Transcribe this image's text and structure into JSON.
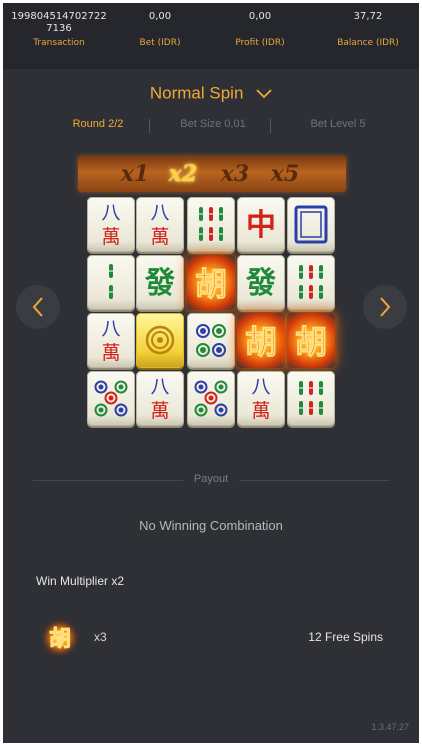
{
  "header": {
    "transaction": {
      "value_line1": "199804514702722",
      "value_line2": "7136",
      "label": "Transaction"
    },
    "bet": {
      "value": "0,00",
      "label": "Bet (IDR)"
    },
    "profit": {
      "value": "0,00",
      "label": "Profit (IDR)"
    },
    "balance": {
      "value": "37,72",
      "label": "Balance (IDR)"
    }
  },
  "mode": {
    "label": "Normal Spin",
    "icon": "chevron-down-icon"
  },
  "info": {
    "round": "Round 2/2",
    "bet_size": "Bet Size 0,01",
    "bet_level": "Bet Level 5"
  },
  "multipliers": {
    "items": [
      "x1",
      "x2",
      "x3",
      "x5"
    ],
    "active": "x2"
  },
  "reels": {
    "rows": [
      [
        "wan-8",
        "wan-8",
        "bamboo-6",
        "red-dragon",
        "white-dragon"
      ],
      [
        "bamboo-2",
        "green-dragon",
        "wild-hu",
        "green-dragon",
        "bamboo-6"
      ],
      [
        "wan-8",
        "golden-dot-1",
        "dots-4",
        "wild-hu",
        "wild-hu"
      ],
      [
        "dots-5",
        "wan-8",
        "dots-5",
        "wan-8",
        "bamboo-6"
      ]
    ]
  },
  "nav": {
    "left_icon": "chevron-left-icon",
    "right_icon": "chevron-right-icon"
  },
  "payout": {
    "label": "Payout",
    "message": "No Winning Combination"
  },
  "win_multiplier": "Win Multiplier x2",
  "free_spins": {
    "icon": "scatter-hu-icon",
    "count": "x3",
    "spins": "12 Free Spins"
  },
  "version": "1.3.47.27",
  "colors": {
    "accent": "#f0a83a",
    "background": "#2e3036",
    "header": "#25272c",
    "active_multiplier": "#ffd23a"
  }
}
